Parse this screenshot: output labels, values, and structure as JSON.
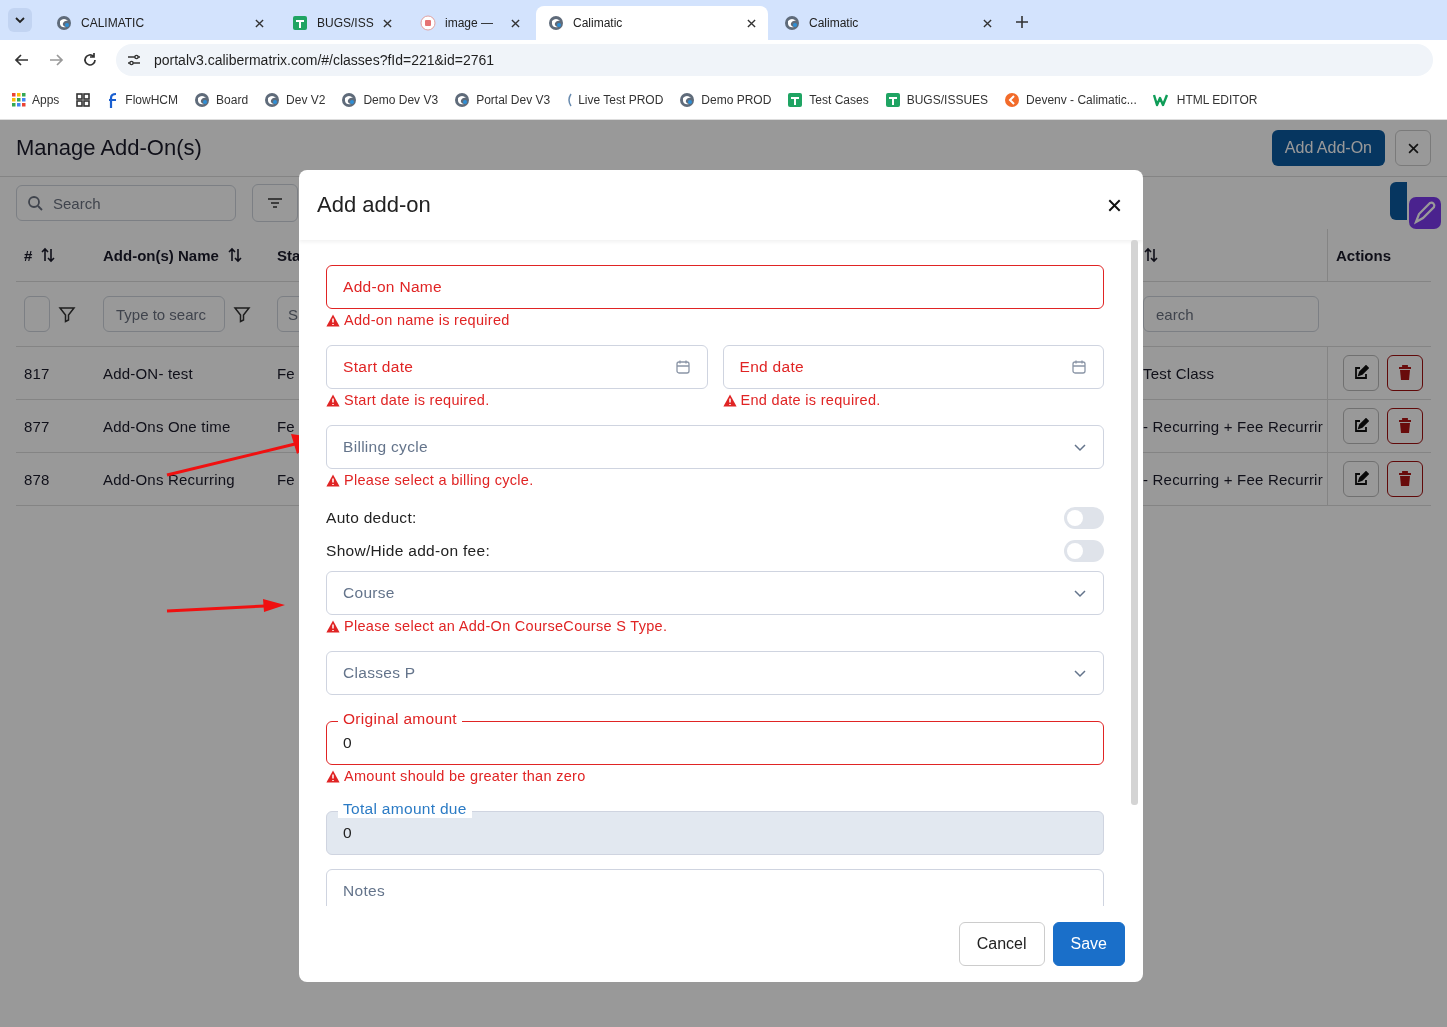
{
  "browser": {
    "tabs": [
      {
        "title": "CALIMATIC",
        "kind": "calimatic",
        "selected": false
      },
      {
        "title": "BUGS/ISS",
        "kind": "sheets",
        "selected": false
      },
      {
        "title": "image —",
        "kind": "image",
        "selected": false
      },
      {
        "title": "Calimatic",
        "kind": "calimatic",
        "selected": true
      },
      {
        "title": "Calimatic",
        "kind": "calimatic",
        "selected": false
      }
    ],
    "url": "portalv3.calibermatrix.com/#/classes?fId=221&id=2761",
    "bookmarks": [
      {
        "label": "Apps",
        "kind": "apps"
      },
      {
        "kind": "grid"
      },
      {
        "label": "FlowHCM",
        "kind": "flow"
      },
      {
        "label": "Board",
        "kind": "calimatic"
      },
      {
        "label": "Dev V2",
        "kind": "calimatic"
      },
      {
        "label": "Demo Dev V3",
        "kind": "calimatic"
      },
      {
        "label": "Portal Dev V3",
        "kind": "calimatic"
      },
      {
        "label": "Live Test PROD",
        "kind": "partial"
      },
      {
        "label": "Demo PROD",
        "kind": "calimatic"
      },
      {
        "label": "Test Cases",
        "kind": "sheets"
      },
      {
        "label": "BUGS/ISSUES",
        "kind": "sheets"
      },
      {
        "label": "Devenv - Calimatic...",
        "kind": "devenv"
      },
      {
        "label": "HTML EDITOR",
        "kind": "w"
      }
    ]
  },
  "page": {
    "title": "Manage Add-On(s)",
    "add_button": "Add Add-On",
    "search": {
      "placeholder": "Search"
    },
    "columns": [
      {
        "label": "#",
        "kind": "sortable"
      },
      {
        "label": "Add-on(s) Name",
        "kind": "sortable"
      },
      {
        "label": "Sta",
        "kind": "plain"
      },
      {
        "kind": "sortable"
      },
      {
        "label": "Actions",
        "kind": "plain"
      }
    ],
    "filters": [
      {
        "kind": "with_filter"
      },
      {
        "placeholder": "Type to searc",
        "kind": "with_filter"
      },
      {
        "placeholder": "S",
        "kind": "plain"
      },
      {
        "placeholder": "earch",
        "kind": "plain"
      }
    ],
    "rows": [
      {
        "cells": [
          "817",
          "Add-ON- test",
          "Fe",
          "Test Class"
        ]
      },
      {
        "cells": [
          "877",
          "Add-Ons One time",
          "Fe",
          "- Recurring + Fee Recurrir"
        ]
      },
      {
        "cells": [
          "878",
          "Add-Ons Recurring",
          "Fe",
          "- Recurring + Fee Recurrir"
        ]
      }
    ]
  },
  "modal": {
    "title": "Add add-on",
    "fields": [
      {
        "kind": "text",
        "label": "Add-on Name",
        "invalid": true,
        "error": "Add-on name is required"
      },
      {
        "kind": "date_pair",
        "items": [
          {
            "label": "Start date",
            "invalid": true,
            "error": "Start date is required."
          },
          {
            "label": "End date",
            "invalid": true,
            "error": "End date is required."
          }
        ]
      },
      {
        "kind": "select",
        "label": "Billing cycle",
        "error": "Please select a billing cycle."
      },
      {
        "kind": "toggle",
        "label": "Auto deduct:",
        "on": false
      },
      {
        "kind": "toggle",
        "label": "Show/Hide add-on fee:",
        "on": false
      },
      {
        "kind": "select",
        "label": "Course",
        "error": "Please select an Add-On CourseCourse S Type."
      },
      {
        "kind": "select",
        "label": "Classes P"
      },
      {
        "kind": "amount",
        "label": "Original amount",
        "value": "0",
        "invalid": true,
        "disabled": false,
        "error": "Amount should be greater than zero"
      },
      {
        "kind": "amount",
        "label": "Total amount due",
        "value": "0",
        "invalid": false,
        "disabled": true
      },
      {
        "kind": "text",
        "label": "Notes",
        "invalid": false
      }
    ],
    "buttons": [
      {
        "label": "Cancel",
        "kind": "secondary"
      },
      {
        "label": "Save",
        "kind": "primary"
      }
    ]
  }
}
